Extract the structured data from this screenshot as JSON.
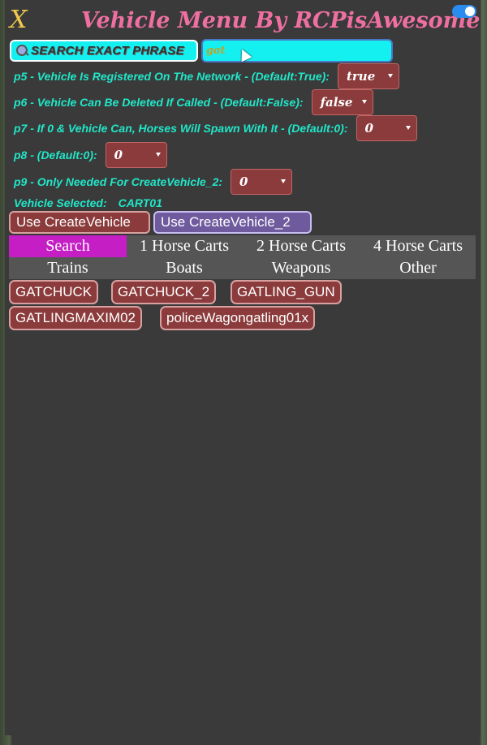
{
  "window": {
    "title": "Vehicle Menu By RCPisAwesome",
    "close_label": "X"
  },
  "search": {
    "label": "SEARCH EXACT PHRASE",
    "value": "gat"
  },
  "params": [
    {
      "label": "p5 - Vehicle Is Registered On The Network - (Default:True):",
      "value": "true"
    },
    {
      "label": "p6 - Vehicle Can Be Deleted If Called - (Default:False):",
      "value": "false"
    },
    {
      "label": "p7 - If 0 & Vehicle Can, Horses Will Spawn With It - (Default:0):",
      "value": "0"
    },
    {
      "label": "p8 - (Default:0):",
      "value": "0"
    },
    {
      "label": "p9 - Only Needed For CreateVehicle_2:",
      "value": "0"
    }
  ],
  "selected": {
    "label": "Vehicle Selected:",
    "value": "CART01"
  },
  "buttons": {
    "create1": "Use CreateVehicle",
    "create2": "Use CreateVehicle_2"
  },
  "tabs": [
    "Search",
    "1 Horse Carts",
    "2 Horse Carts",
    "4 Horse Carts",
    "Trains",
    "Boats",
    "Weapons",
    "Other"
  ],
  "results": [
    "GATCHUCK",
    "GATCHUCK_2",
    "GATLING_GUN",
    "GATLINGMAXIM02",
    "policeWagongatling01x"
  ],
  "colors": {
    "panel": "#3a3a3a",
    "title": "#ee6fa0",
    "label_cyan": "#21e6c8",
    "input_bg": "#14f0f0",
    "select_bg": "#8b3b3b",
    "tab_active": "#c41ec4",
    "toggle": "#2b8cf0"
  }
}
